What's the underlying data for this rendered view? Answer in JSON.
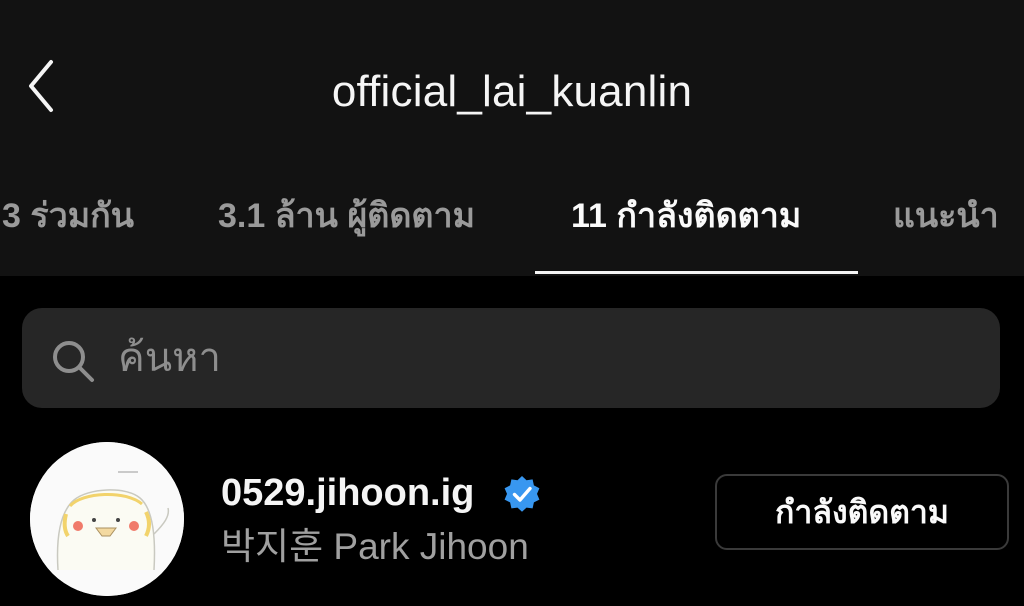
{
  "header": {
    "title": "official_lai_kuanlin",
    "back_icon": "chevron-left-icon"
  },
  "tabs": [
    {
      "label": "3 ร่วมกัน",
      "active": false
    },
    {
      "label": "3.1 ล้าน ผู้ติดตาม",
      "active": false
    },
    {
      "label": "11 กำลังติดตาม",
      "active": true
    },
    {
      "label": "แนะนำ",
      "active": false
    }
  ],
  "search": {
    "placeholder": "ค้นหา",
    "icon": "search-icon"
  },
  "following_list": [
    {
      "username": "0529.jihoon.ig",
      "verified": true,
      "full_name": "박지훈 Park Jihoon",
      "button_label": "กำลังติดตาม"
    }
  ],
  "colors": {
    "background": "#000000",
    "header_background": "#121212",
    "search_background": "#262626",
    "verified_badge": "#3897f0",
    "muted_text": "#8e8e8e"
  }
}
